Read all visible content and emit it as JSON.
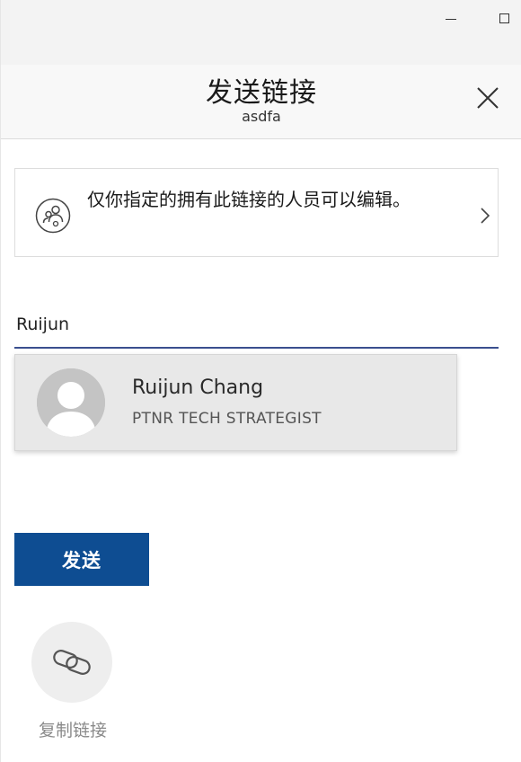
{
  "window": {
    "minimize_icon": "minimize-icon",
    "maximize_icon": "maximize-icon"
  },
  "dialog": {
    "title": "发送链接",
    "subtitle": "asdfa",
    "close_icon": "close-icon"
  },
  "permission": {
    "text": "仅你指定的拥有此链接的人员可以编辑。",
    "icon": "people-icon",
    "chevron_icon": "chevron-right-icon"
  },
  "recipient": {
    "value": "Ruijun",
    "placeholder": ""
  },
  "suggestions": [
    {
      "name": "Ruijun Chang",
      "title": "PTNR TECH STRATEGIST",
      "avatar_icon": "person-avatar-icon"
    }
  ],
  "actions": {
    "send_label": "发送",
    "copy_link_label": "复制链接",
    "copy_link_icon": "link-icon"
  },
  "colors": {
    "accent": "#0e4d92",
    "input_underline": "#3a4f8f",
    "suggestion_bg": "#e8e8e8"
  }
}
